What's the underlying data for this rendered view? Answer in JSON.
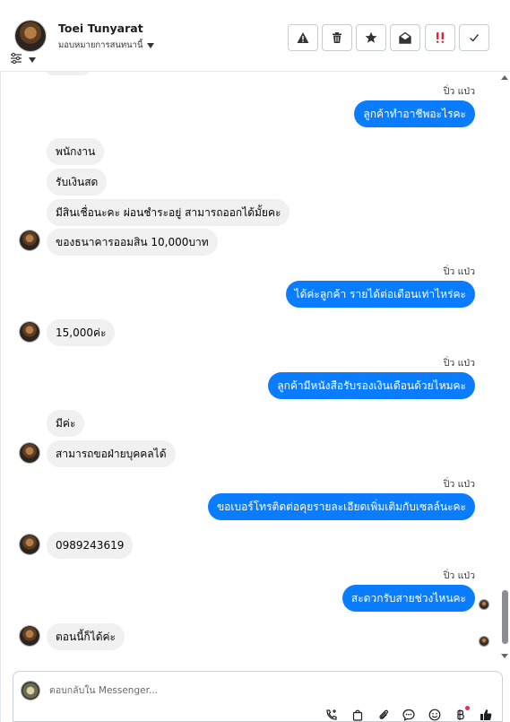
{
  "header": {
    "contact_name": "Toei Tunyarat",
    "assign_label": "มอบหมายการสนทนานี้",
    "actions": [
      {
        "name": "report-button",
        "icon": "warning-triangle-icon"
      },
      {
        "name": "delete-button",
        "icon": "trash-icon"
      },
      {
        "name": "star-button",
        "icon": "star-icon"
      },
      {
        "name": "mark-unread-button",
        "icon": "envelope-open-icon"
      },
      {
        "name": "spam-button",
        "icon": "double-exclamation-icon"
      },
      {
        "name": "done-button",
        "icon": "check-icon"
      }
    ]
  },
  "messages": [
    {
      "id": "m1",
      "sender_label": "ปิ่ว แป่ว",
      "text": "ลูกค้าทำอาชีพอะไรคะ",
      "direction": "out"
    },
    {
      "id": "m2",
      "text": "พนักงาน",
      "direction": "in"
    },
    {
      "id": "m3",
      "text": "รับเงินสด",
      "direction": "in"
    },
    {
      "id": "m4",
      "text": "มีสินเชื่อนะคะ ผ่อนชำระอยู่ สามารถออกได้มั้ยคะ",
      "direction": "in"
    },
    {
      "id": "m5",
      "text": "ของธนาคารออมสิน 10,000บาท",
      "direction": "in"
    },
    {
      "id": "m6",
      "sender_label": "ปิ่ว แป่ว",
      "text": "ได้ค่ะลูกค้า  รายได้ต่อเดือนเท่าไหร่คะ",
      "direction": "out"
    },
    {
      "id": "m7",
      "text": "15,000ค่ะ",
      "direction": "in"
    },
    {
      "id": "m8",
      "sender_label": "ปิ่ว แป่ว",
      "text": "ลูกค้ามีหนังสือรับรองเงินเดือนด้วยไหมคะ",
      "direction": "out"
    },
    {
      "id": "m9",
      "text": "มีค่ะ",
      "direction": "in"
    },
    {
      "id": "m10",
      "text": "สามารถขอฝ่ายบุคคลได้",
      "direction": "in"
    },
    {
      "id": "m11",
      "sender_label": "ปิ่ว แป่ว",
      "text": "ขอเบอร์โทรติดต่อคุยรายละเอียดเพิ่มเติมกับเซลล์นะคะ",
      "direction": "out"
    },
    {
      "id": "m12",
      "text": "0989243619",
      "direction": "in"
    },
    {
      "id": "m13",
      "sender_label": "ปิ่ว แป่ว",
      "text": "สะดวกรับสายช่วงไหนคะ",
      "direction": "out"
    },
    {
      "id": "m14",
      "text": "ตอนนี้ก็ได้ค่ะ",
      "direction": "in"
    }
  ],
  "composer": {
    "placeholder": "ตอบกลับใน Messenger..."
  },
  "colors": {
    "outgoing_bubble": "#0a7cff",
    "incoming_bubble": "#f0f0f0",
    "spam_icon": "#e41e3f",
    "like_icon": "#1c1e21"
  }
}
